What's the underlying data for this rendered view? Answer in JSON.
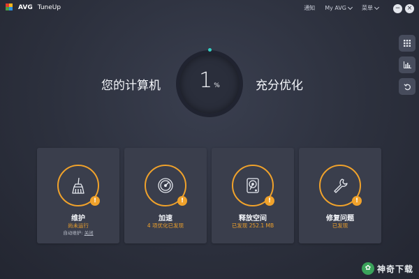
{
  "app": {
    "brand": "AVG",
    "product": "TuneUp"
  },
  "topnav": {
    "notifications": "通知",
    "myavg": "My AVG",
    "menu": "菜单"
  },
  "window": {
    "minimize": "−",
    "close": "×"
  },
  "gauge": {
    "value": "1",
    "unit": "%",
    "label_left": "您的计算机",
    "label_right": "充分优化"
  },
  "cards": [
    {
      "title": "维护",
      "status": "尚未运行",
      "sub_prefix": "自动维护:",
      "sub_link": "关闭"
    },
    {
      "title": "加速",
      "status": "4 项优化已发现"
    },
    {
      "title": "释放空间",
      "status": "已发现 252.1 MB"
    },
    {
      "title": "修复问题",
      "status": "已发现"
    }
  ],
  "warn_symbol": "!",
  "watermark": {
    "text": "神奇下载"
  },
  "colors": {
    "accent_warning": "#f0a22b",
    "gauge_dot": "#35d0c4",
    "background": "#2c303d"
  }
}
